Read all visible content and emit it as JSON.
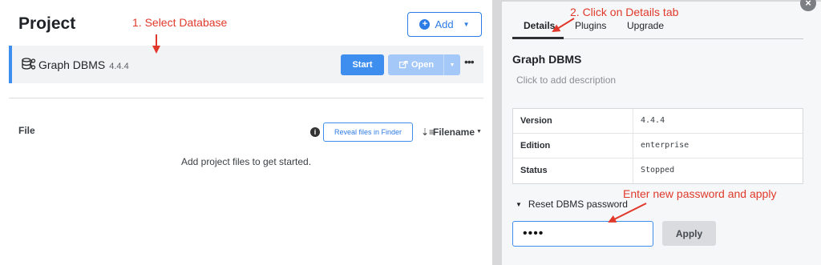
{
  "project": {
    "title": "Project",
    "add_label": "Add",
    "database": {
      "name": "Graph DBMS",
      "version": "4.4.4",
      "start_label": "Start",
      "open_label": "Open",
      "more_label": "•••"
    },
    "files": {
      "header": "File",
      "reveal_label": "Reveal files in Finder",
      "sort_label": "Filename",
      "empty_message": "Add project files to get started."
    }
  },
  "details": {
    "close_label": "×",
    "tabs": [
      {
        "label": "Details",
        "active": true
      },
      {
        "label": "Plugins",
        "active": false
      },
      {
        "label": "Upgrade",
        "active": false
      }
    ],
    "title": "Graph DBMS",
    "description_placeholder": "Click to add description",
    "properties": [
      {
        "key": "Version",
        "value": "4.4.4"
      },
      {
        "key": "Edition",
        "value": "enterprise"
      },
      {
        "key": "Status",
        "value": "Stopped"
      }
    ],
    "reset": {
      "toggle_label": "Reset DBMS password",
      "password_value": "••••",
      "apply_label": "Apply"
    }
  },
  "annotations": {
    "step1": "1. Select Database",
    "step2": "2. Click on Details tab",
    "step3": "Enter new password and apply"
  },
  "colors": {
    "accent": "#3e8ef0",
    "annotation": "#e0392b"
  },
  "icons": [
    "plus-circle-icon",
    "database-icon",
    "open-external-icon",
    "info-icon",
    "sort-icon",
    "close-icon",
    "caret-down-icon"
  ]
}
